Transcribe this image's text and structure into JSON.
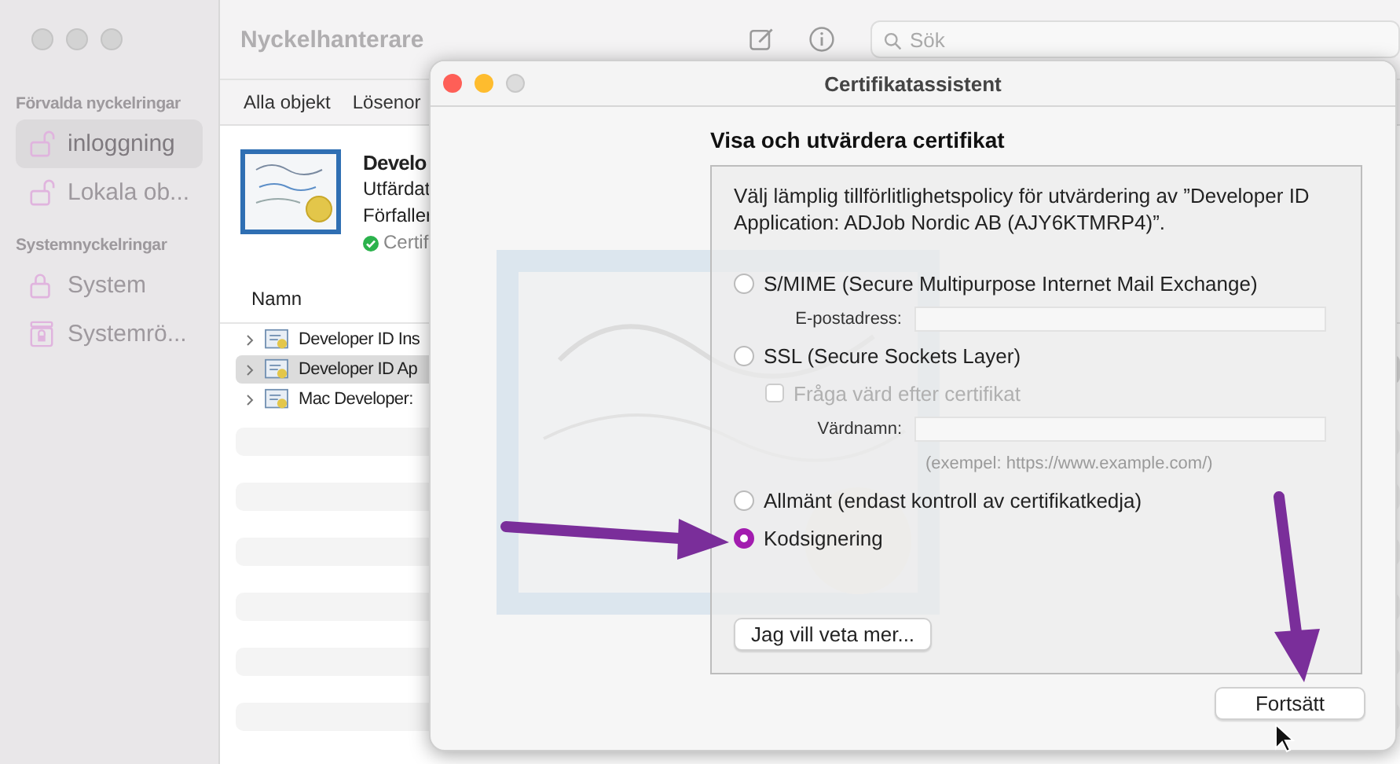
{
  "app": {
    "title": "Nyckelhanterare",
    "search": {
      "placeholder": "Sök"
    },
    "sidebar": {
      "sections": [
        {
          "title": "Förvalda nyckelringar",
          "items": [
            {
              "label": "inloggning",
              "kind": "lock",
              "locked": false,
              "selected": true
            },
            {
              "label": "Lokala ob...",
              "kind": "lock",
              "locked": false,
              "selected": false
            }
          ]
        },
        {
          "title": "Systemnyckelringar",
          "items": [
            {
              "label": "System",
              "kind": "lock",
              "locked": true,
              "selected": false
            },
            {
              "label": "Systemrö...",
              "kind": "vault",
              "locked": true,
              "selected": false
            }
          ]
        }
      ]
    },
    "tabs": [
      {
        "label": "Alla objekt",
        "selected": false
      },
      {
        "label": "Lösenor",
        "selected": false
      }
    ],
    "detail": {
      "name": "Develo",
      "issuer": "Utfärdat",
      "expires": "Förfaller",
      "status": "Certif",
      "valid": true
    },
    "table": {
      "columns": [
        "Namn"
      ],
      "rows": [
        {
          "name": "Developer ID Ins",
          "selected": false
        },
        {
          "name": "Developer ID Ap",
          "selected": true
        },
        {
          "name": "Mac Developer:",
          "selected": false
        }
      ]
    }
  },
  "dialog": {
    "title": "Certifikatassistent",
    "heading": "Visa och utvärdera certifikat",
    "description": "Välj lämplig tillförlitlighetspolicy för utvärdering av ”Developer ID Application: ADJob Nordic AB (AJY6KTMRP4)”.",
    "items": [
      {
        "kind": "radio",
        "label": "S/MIME (Secure Multipurpose Internet Mail Exchange)",
        "selected": false
      },
      {
        "kind": "field",
        "label": "E-postadress:"
      },
      {
        "kind": "radio",
        "label": "SSL (Secure Sockets Layer)",
        "selected": false
      },
      {
        "kind": "checkbox",
        "label": "Fråga värd efter certifikat",
        "checked": false,
        "disabled": true
      },
      {
        "kind": "field",
        "label": "Värdnamn:"
      },
      {
        "kind": "hint",
        "label": "(exempel: https://www.example.com/)"
      },
      {
        "kind": "radio",
        "label": "Allmänt (endast kontroll av certifikatkedja)",
        "selected": false
      },
      {
        "kind": "radio",
        "label": "Kodsignering",
        "selected": true
      }
    ],
    "help_button": "Jag vill veta mer...",
    "continue_button": "Fortsätt"
  }
}
